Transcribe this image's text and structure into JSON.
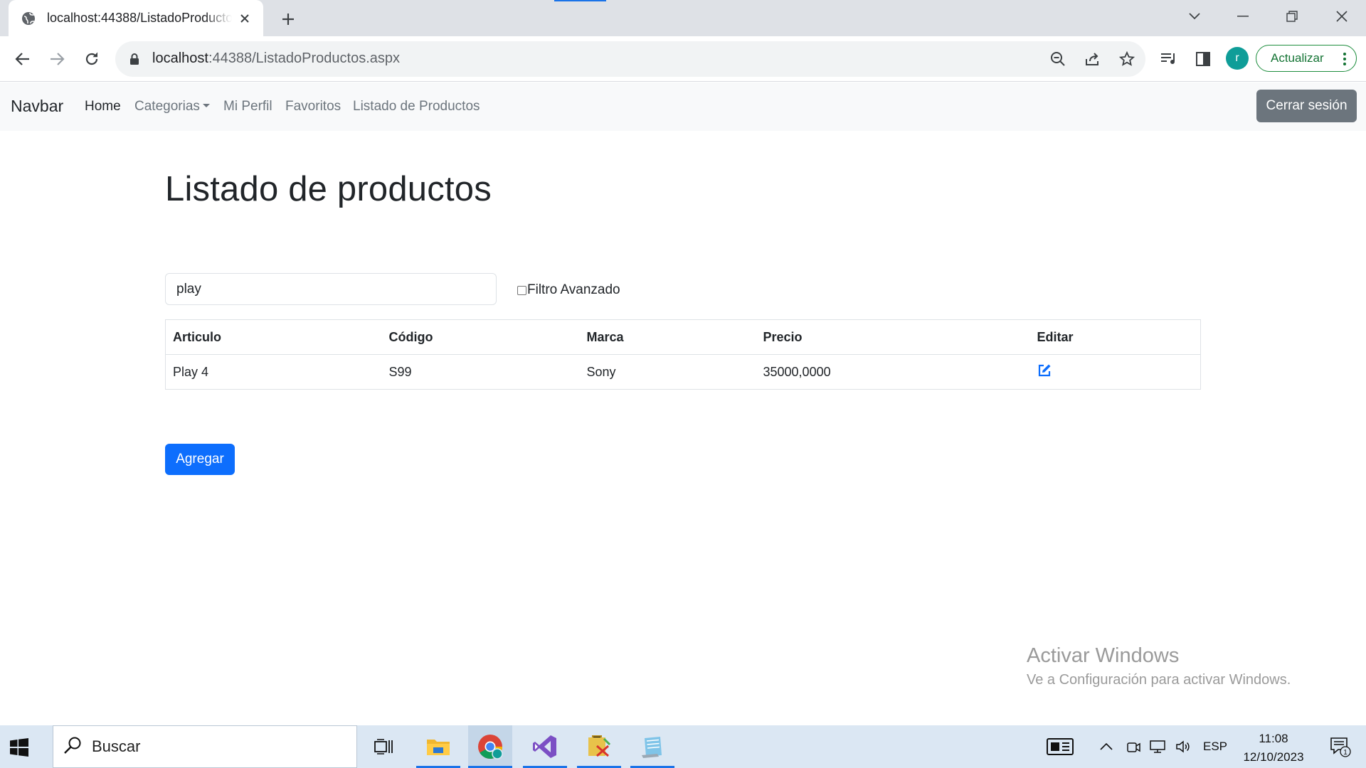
{
  "browser": {
    "tab_title": "localhost:44388/ListadoProductos.aspx",
    "url_host": "localhost",
    "url_path": ":44388/ListadoProductos.aspx",
    "profile_initial": "r",
    "update_label": "Actualizar"
  },
  "navbar": {
    "brand": "Navbar",
    "links": [
      "Home",
      "Categorias",
      "Mi Perfil",
      "Favoritos",
      "Listado de Productos"
    ],
    "logout": "Cerrar sesión"
  },
  "page": {
    "title": "Listado de productos",
    "search_value": "play",
    "filter_label": "Filtro Avanzado",
    "table": {
      "headers": [
        "Articulo",
        "Código",
        "Marca",
        "Precio",
        "Editar"
      ],
      "rows": [
        {
          "articulo": "Play 4",
          "codigo": "S99",
          "marca": "Sony",
          "precio": "35000,0000"
        }
      ]
    },
    "add_button": "Agregar"
  },
  "watermark": {
    "line1": "Activar Windows",
    "line2": "Ve a Configuración para activar Windows."
  },
  "taskbar": {
    "search_placeholder": "Buscar",
    "language": "ESP",
    "time": "11:08",
    "date": "12/10/2023",
    "notification_count": "1"
  },
  "colors": {
    "primary": "#0d6efd",
    "secondary": "#6c757d",
    "navbar_bg": "#f8f9fa",
    "chrome_tabstrip": "#dee1e6",
    "taskbar": "#dbe7f3"
  }
}
